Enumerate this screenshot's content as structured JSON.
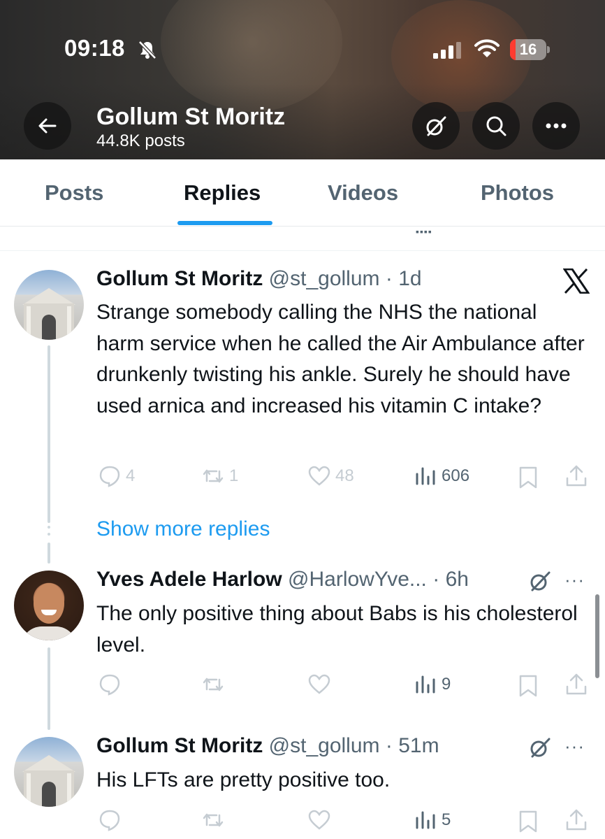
{
  "status_bar": {
    "time": "09:18",
    "battery": "16",
    "battery_level": 0.16
  },
  "header": {
    "profile_name": "Gollum St Moritz",
    "posts_count": "44.8K posts",
    "icons": [
      "back-arrow-icon",
      "grok-icon",
      "search-icon",
      "more-icon"
    ]
  },
  "tabs": [
    {
      "label": "Posts",
      "active": false
    },
    {
      "label": "Replies",
      "active": true
    },
    {
      "label": "Videos",
      "active": false
    },
    {
      "label": "Photos",
      "active": false
    }
  ],
  "posts": [
    {
      "name": "Gollum St Moritz",
      "handle": "@st_gollum",
      "time": "1d",
      "text": "Strange somebody calling the NHS the national harm service when he called the Air Ambulance after drunkenly twisting his ankle. Surely he should have used arnica and increased his vitamin C intake?",
      "replies": "4",
      "reposts": "1",
      "likes": "48",
      "views": "606"
    },
    {
      "name": "Yves Adele Harlow",
      "handle": "@HarlowYve...",
      "time": "6h",
      "text": "The only positive thing about Babs is his cholesterol level.",
      "views": "9"
    },
    {
      "name": "Gollum St Moritz",
      "handle": "@st_gollum",
      "time": "51m",
      "text": "His LFTs are pretty positive too.",
      "views": "5"
    }
  ],
  "show_more_replies": "Show more replies",
  "colors": {
    "accent": "#1d9bf0",
    "text": "#0f1419",
    "muted": "#536471"
  }
}
